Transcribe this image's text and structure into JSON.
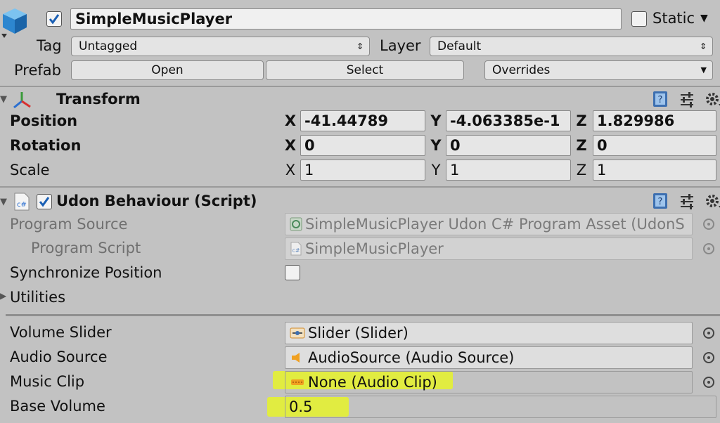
{
  "header": {
    "object_name": "SimpleMusicPlayer",
    "active_checked": true,
    "static_label": "Static",
    "tag_label": "Tag",
    "tag_value": "Untagged",
    "layer_label": "Layer",
    "layer_value": "Default",
    "prefab_label": "Prefab",
    "open_button": "Open",
    "select_button": "Select",
    "overrides_dropdown": "Overrides"
  },
  "transform": {
    "title": "Transform",
    "rows": [
      {
        "label": "Position",
        "x": "-41.44789",
        "y": "-4.063385e-1",
        "z": "1.829986"
      },
      {
        "label": "Rotation",
        "x": "0",
        "y": "0",
        "z": "0"
      },
      {
        "label": "Scale",
        "x": "1",
        "y": "1",
        "z": "1"
      }
    ],
    "axis_labels": {
      "x": "X",
      "y": "Y",
      "z": "Z"
    }
  },
  "udon": {
    "title": "Udon Behaviour (Script)",
    "program_source_label": "Program Source",
    "program_source_value": "SimpleMusicPlayer Udon C# Program Asset (UdonS",
    "program_script_label": "Program Script",
    "program_script_value": "SimpleMusicPlayer",
    "sync_position_label": "Synchronize Position",
    "utilities_label": "Utilities"
  },
  "fields": {
    "volume_slider_label": "Volume Slider",
    "volume_slider_value": "Slider (Slider)",
    "audio_source_label": "Audio Source",
    "audio_source_value": "AudioSource (Audio Source)",
    "music_clip_label": "Music Clip",
    "music_clip_value": "None (Audio Clip)",
    "base_volume_label": "Base Volume",
    "base_volume_value": "0.5"
  },
  "colors": {
    "background": "#c2c2c2",
    "highlight": "#e6f32a",
    "checkbox_blue": "#1a5fb4"
  },
  "icons": {
    "game_object": "cube-icon",
    "transform": "transform-axes-icon",
    "script": "csharp-script-icon",
    "help": "help-book-icon",
    "presets": "presets-sliders-icon",
    "settings": "gear-icon"
  }
}
